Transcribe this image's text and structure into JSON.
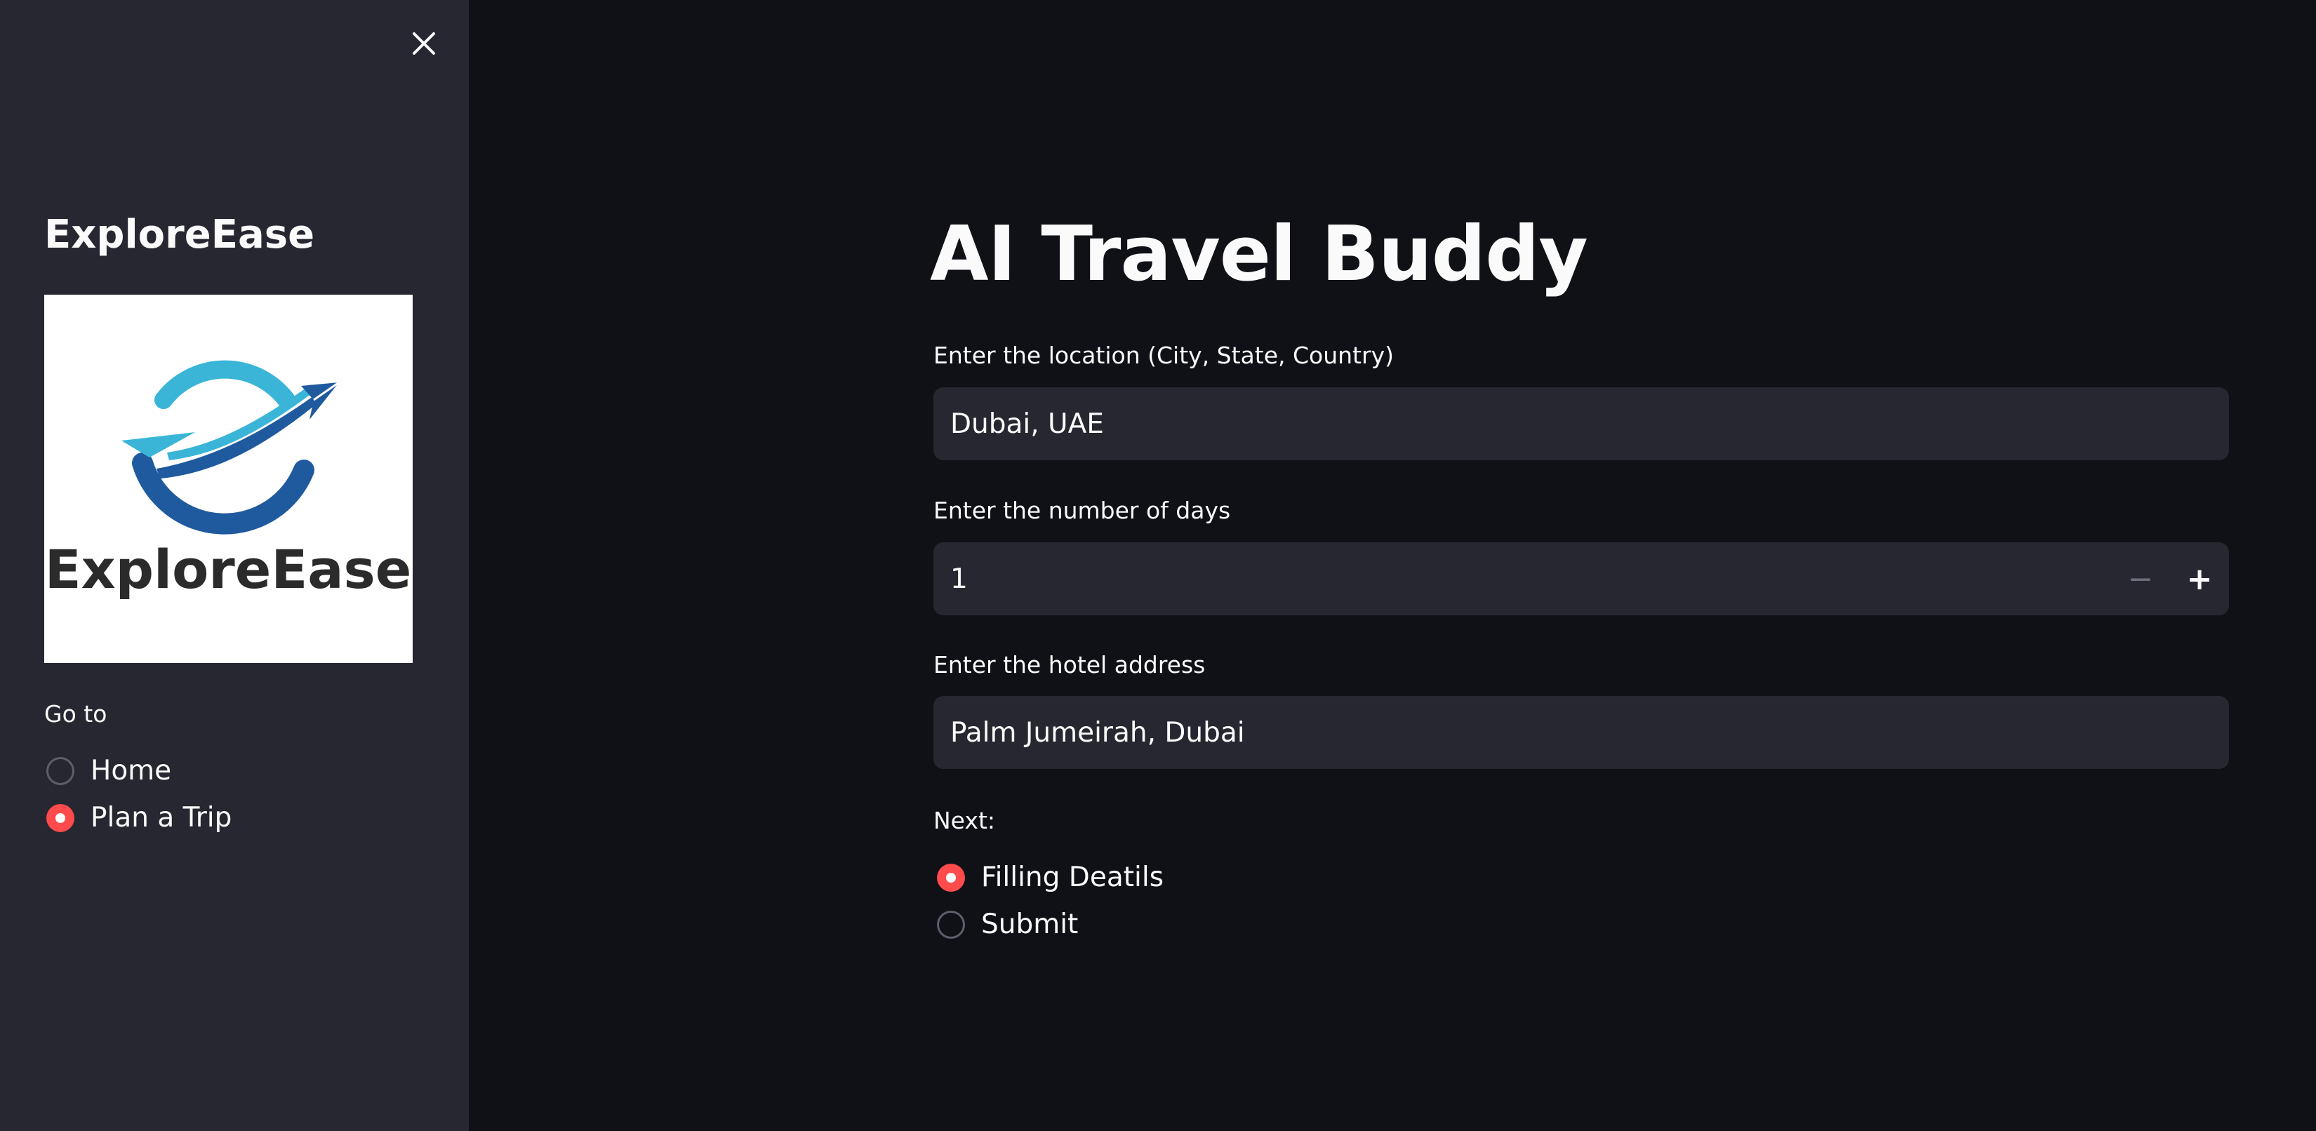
{
  "sidebar": {
    "brand_title": "ExploreEase",
    "logo_text": "ExploreEase",
    "nav_label": "Go to",
    "nav_options": [
      "Home",
      "Plan a Trip"
    ],
    "nav_selected": "Plan a Trip"
  },
  "main": {
    "title": "AI Travel Buddy",
    "location": {
      "label": "Enter the location (City, State, Country)",
      "value": "Dubai, UAE"
    },
    "days": {
      "label": "Enter the number of days",
      "value": "1",
      "decrement": "−",
      "increment": "+"
    },
    "hotel": {
      "label": "Enter the hotel address",
      "value": "Palm Jumeirah, Dubai"
    },
    "next": {
      "label": "Next:",
      "options": [
        "Filling Deatils",
        "Submit"
      ],
      "selected": "Filling Deatils"
    }
  },
  "colors": {
    "background": "#0f1117",
    "sidebar": "#262730",
    "input_bg": "#262730",
    "accent": "#ff4b4b",
    "text": "#fafafa",
    "logo_blue_light": "#3ab5d8",
    "logo_blue_dark": "#1f5a9e",
    "logo_text": "#2b2b2b"
  },
  "icons": {
    "close": "close-icon",
    "logo": "airplane-orbit-logo"
  }
}
